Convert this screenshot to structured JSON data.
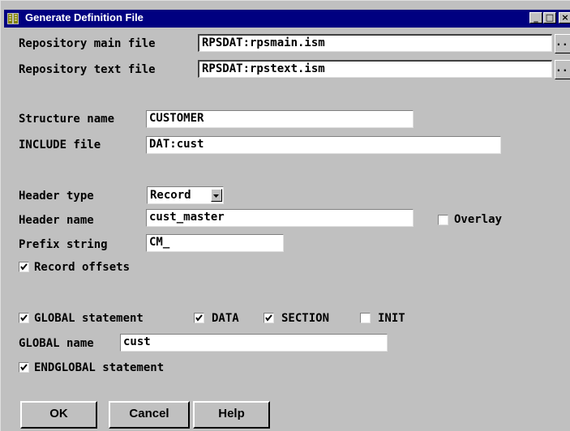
{
  "window": {
    "title": "Generate Definition File",
    "controls": {
      "minimize": "_",
      "maximize": "□",
      "close": "×"
    }
  },
  "repository": {
    "main_label": "Repository main file",
    "main_value": "RPSDAT:rpsmain.ism",
    "text_label": "Repository text file",
    "text_value": "RPSDAT:rpstext.ism",
    "browse_label": "..."
  },
  "structure": {
    "name_label": "Structure name",
    "name_value": "CUSTOMER",
    "include_label": "INCLUDE file",
    "include_value": "DAT:cust"
  },
  "header": {
    "type_label": "Header type",
    "type_value": "Record",
    "name_label": "Header name",
    "name_value": "cust_master",
    "overlay_label": "Overlay",
    "overlay_checked": false,
    "prefix_label": "Prefix string",
    "prefix_value": "CM_",
    "record_offsets_label": "Record offsets",
    "record_offsets_checked": true
  },
  "global": {
    "statement_label": "GLOBAL statement",
    "statement_checked": true,
    "data_label": "DATA",
    "data_checked": true,
    "section_label": "SECTION",
    "section_checked": true,
    "init_label": "INIT",
    "init_checked": false,
    "name_label": "GLOBAL name",
    "name_value": "cust",
    "endglobal_label": "ENDGLOBAL statement",
    "endglobal_checked": true
  },
  "buttons": {
    "ok": "OK",
    "cancel": "Cancel",
    "help": "Help"
  },
  "colors": {
    "titlebar": "#000080",
    "face": "#c0c0c0",
    "field": "#ffffff"
  }
}
